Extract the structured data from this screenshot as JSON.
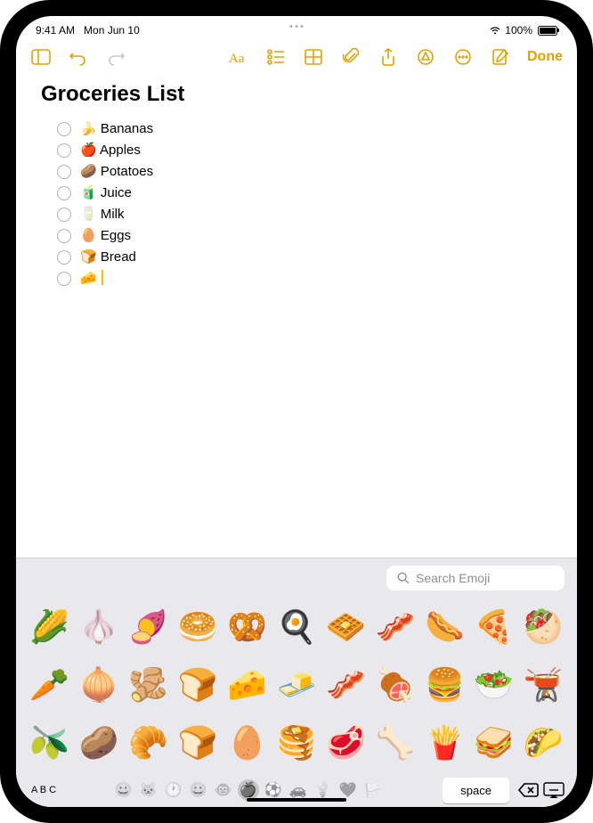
{
  "status": {
    "time": "9:41 AM",
    "date": "Mon Jun 10",
    "battery_pct": "100%"
  },
  "toolbar": {
    "done_label": "Done"
  },
  "note": {
    "title": "Groceries List",
    "items": [
      {
        "emoji": "🍌",
        "label": "Bananas"
      },
      {
        "emoji": "🍎",
        "label": "Apples"
      },
      {
        "emoji": "🥔",
        "label": "Potatoes"
      },
      {
        "emoji": "🧃",
        "label": "Juice"
      },
      {
        "emoji": "🥛",
        "label": "Milk"
      },
      {
        "emoji": "🥚",
        "label": "Eggs"
      },
      {
        "emoji": "🍞",
        "label": "Bread"
      },
      {
        "emoji": "🧀",
        "label": ""
      }
    ]
  },
  "keyboard": {
    "search_placeholder": "Search Emoji",
    "abc_label": "A B C",
    "space_label": "space",
    "emoji_rows": [
      [
        "🌽",
        "🧄",
        "🍠",
        "🥯",
        "🥨",
        "🍳",
        "🧇",
        "🥓",
        "🌭",
        "🍕",
        "🥙"
      ],
      [
        "🥕",
        "🧅",
        "🫚",
        "🍞",
        "🧀",
        "🧈",
        "🥓",
        "🍖",
        "🍔",
        "🥗",
        "🫕"
      ],
      [
        "🫒",
        "🥔",
        "🥐",
        "🍞",
        "🥚",
        "🥞",
        "🥩",
        "🦴",
        "🍟",
        "🥪",
        "🌮"
      ]
    ],
    "nav_category_icons": [
      "😀",
      "🐱",
      "🕐",
      "😀",
      "🐵",
      "🍎",
      "⚽",
      "🚗",
      "💡",
      "❤️",
      "🏳️"
    ]
  }
}
